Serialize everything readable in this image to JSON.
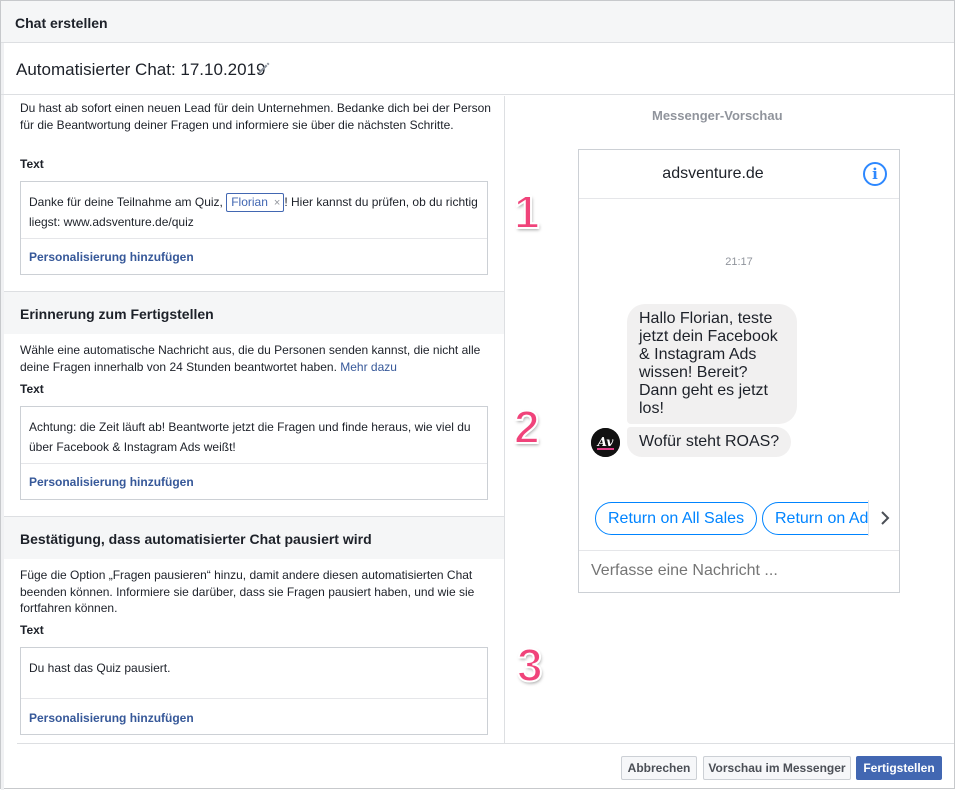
{
  "dialog": {
    "title": "Chat erstellen"
  },
  "chat": {
    "name": "Automatisierter Chat: 17.10.2019"
  },
  "section1": {
    "description": "Du hast ab sofort einen neuen Lead für dein Unternehmen. Bedanke dich bei der Person für die Beantwortung deiner Fragen und informiere sie über die nächsten Schritte.",
    "text_label": "Text",
    "message_before": "Danke für deine Teilnahme am Quiz, ",
    "token": "Florian",
    "token_remove": "×",
    "message_after": "! Hier kannst du prüfen, ob du richtig liegst: www.adsventure.de/quiz",
    "add_personalization": "Personalisierung hinzufügen"
  },
  "section2": {
    "title": "Erinnerung zum Fertigstellen",
    "description": "Wähle eine automatische Nachricht aus, die du Personen senden kannst, die nicht alle deine Fragen innerhalb von 24 Stunden beantwortet haben. ",
    "more_link": "Mehr dazu",
    "text_label": "Text",
    "message": "Achtung: die Zeit läuft ab! Beantworte jetzt die Fragen und finde heraus, wie viel du über Facebook & Instagram Ads weißt!",
    "add_personalization": "Personalisierung hinzufügen"
  },
  "section3": {
    "title": "Bestätigung, dass automatisierter Chat pausiert wird",
    "description": "Füge die Option „Fragen pausieren“ hinzu, damit andere diesen automatisierten Chat beenden können. Informiere sie darüber, dass sie Fragen pausiert haben, und wie sie fortfahren können.",
    "text_label": "Text",
    "message": "Du hast das Quiz pausiert.",
    "add_personalization": "Personalisierung hinzufügen"
  },
  "annotations": {
    "n1": "1",
    "n2": "2",
    "n3": "3",
    "color": "#f0437a"
  },
  "preview": {
    "title": "Messenger-Vorschau",
    "page_name": "adsventure.de",
    "info_icon": "i",
    "time": "21:17",
    "bubble1": "Hallo Florian, teste jetzt dein Facebook & Instagram Ads wissen! Bereit? Dann geht es jetzt los!",
    "bubble2": "Wofür steht ROAS?",
    "avatar_text": "AV",
    "quick_replies": [
      "Return on All Sales",
      "Return on Ad Spend"
    ],
    "compose_placeholder": "Verfasse eine Nachricht ..."
  },
  "footer": {
    "cancel": "Abbrechen",
    "preview": "Vorschau im Messenger",
    "finish": "Fertigstellen"
  },
  "colors": {
    "link": "#365899",
    "primary": "#4267b2",
    "messenger_blue": "#0084ff"
  }
}
